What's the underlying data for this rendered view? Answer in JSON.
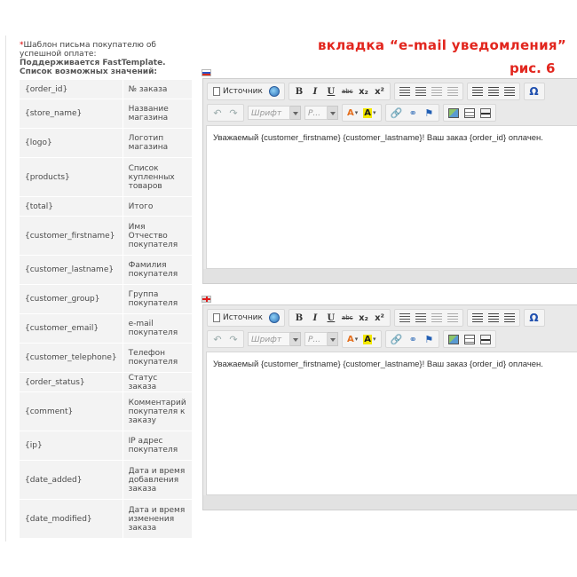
{
  "annotation": {
    "title": "вкладка “e-mail уведомления”",
    "figure": "рис. 6"
  },
  "intro": {
    "required_mark": "*",
    "label": "Шаблон письма покупателю об успешной оплате:",
    "supported": "Поддерживается FastTemplate.",
    "values_list": "Список возможных значений:"
  },
  "variables": [
    {
      "key": "{order_id}",
      "desc": "№ заказа"
    },
    {
      "key": "{store_name}",
      "desc": "Название магазина"
    },
    {
      "key": "{logo}",
      "desc": "Логотип магазина"
    },
    {
      "key": "{products}",
      "desc": "Список купленных товаров"
    },
    {
      "key": "{total}",
      "desc": "Итого"
    },
    {
      "key": "{customer_firstname}",
      "desc": "Имя Отчество покупателя"
    },
    {
      "key": "{customer_lastname}",
      "desc": "Фамилия покупателя"
    },
    {
      "key": "{customer_group}",
      "desc": "Группа покупателя"
    },
    {
      "key": "{customer_email}",
      "desc": "e-mail покупателя"
    },
    {
      "key": "{customer_telephone}",
      "desc": "Телефон покупателя"
    },
    {
      "key": "{order_status}",
      "desc": "Статус заказа"
    },
    {
      "key": "{comment}",
      "desc": "Комментарий покупателя к заказу"
    },
    {
      "key": "{ip}",
      "desc": "IP адрес покупателя"
    },
    {
      "key": "{date_added}",
      "desc": "Дата и время добавления заказа"
    },
    {
      "key": "{date_modified}",
      "desc": "Дата и время изменения заказа"
    }
  ],
  "toolbar": {
    "source": "Источник",
    "bold": "B",
    "italic": "I",
    "underline": "U",
    "strike": "abc",
    "subscript": "x₂",
    "superscript": "x²",
    "omega": "Ω",
    "undo": "↶",
    "redo": "↷",
    "font": "Шрифт",
    "size": "Р...",
    "text_color": "A",
    "bg_color": "A"
  },
  "editors": [
    {
      "lang": "ru",
      "content": "Уважаемый {customer_firstname} {customer_lastname}! Ваш заказ {order_id} оплачен."
    },
    {
      "lang": "en",
      "content": "Уважаемый {customer_firstname} {customer_lastname}! Ваш заказ {order_id} оплачен."
    }
  ],
  "colors": {
    "annotation": "#e2261e",
    "required": "#e00000",
    "table_bg": "#f3f3f3"
  }
}
